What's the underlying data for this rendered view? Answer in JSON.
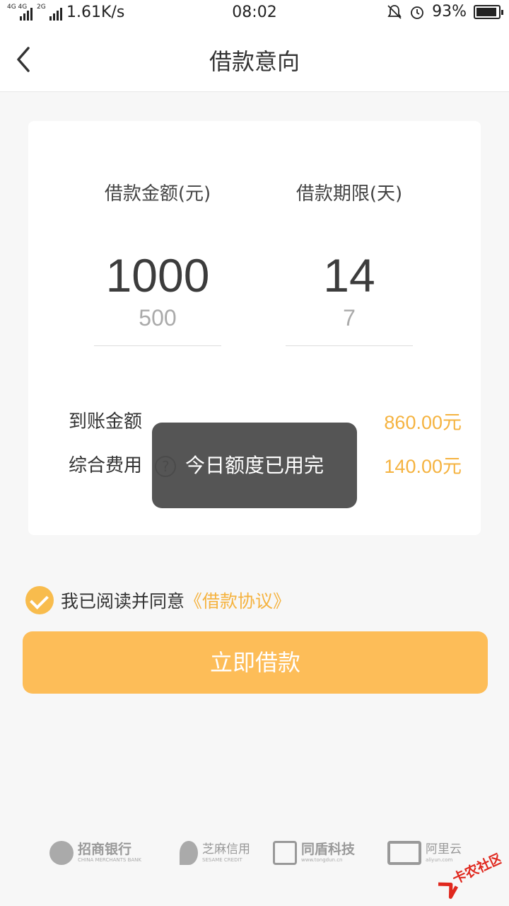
{
  "status_bar": {
    "network_1": "4G 4G",
    "network_2": "2G",
    "speed": "1.61K/s",
    "time": "08:02",
    "battery_percent": "93%",
    "battery_level": 0.93
  },
  "nav": {
    "title": "借款意向"
  },
  "loan": {
    "amount_label": "借款金额(元)",
    "amount_selected": "1000",
    "amount_next": "500",
    "term_label": "借款期限(天)",
    "term_selected": "14",
    "term_next": "7",
    "received_label": "到账金额",
    "received_value": "860.00元",
    "fee_label": "综合费用",
    "fee_value": "140.00元",
    "help_icon": "?"
  },
  "toast": {
    "message": "今日额度已用完"
  },
  "agreement": {
    "text": "我已阅读并同意",
    "link": "《借款协议》",
    "checked": true
  },
  "submit_label": "立即借款",
  "partners": [
    {
      "name": "招商银行",
      "sub": "CHINA MERCHANTS BANK"
    },
    {
      "name": "芝麻信用",
      "sub": "SESAME CREDIT"
    },
    {
      "name": "同盾科技",
      "sub": "www.tongdun.cn"
    },
    {
      "name": "阿里云",
      "sub": "aliyun.com"
    }
  ],
  "watermark": "卡农社区",
  "colors": {
    "accent": "#f5b340",
    "button": "#fdbd58",
    "toast_bg": "#464646"
  }
}
